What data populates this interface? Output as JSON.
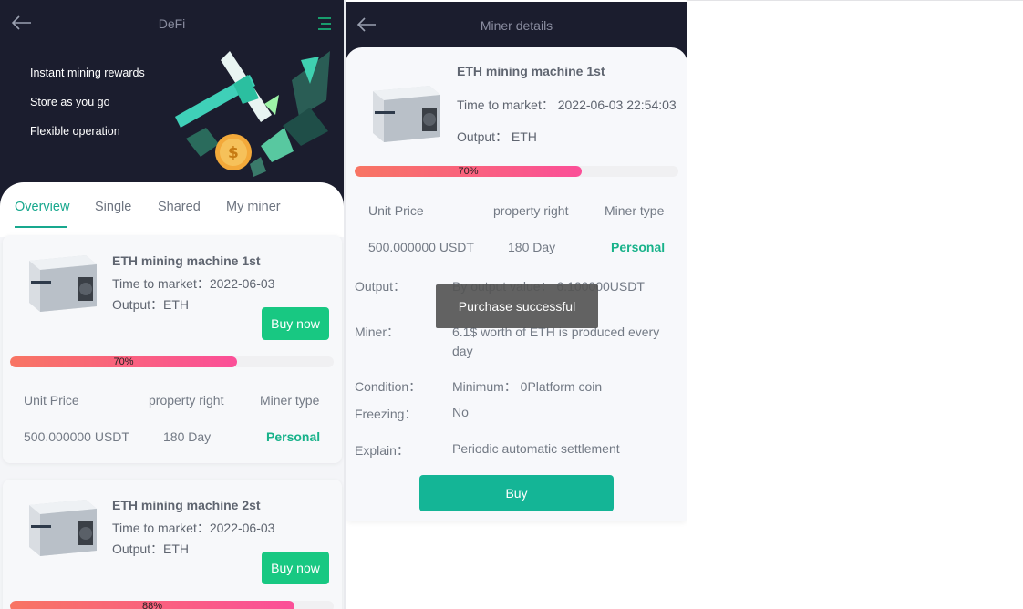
{
  "left": {
    "title": "DeFi",
    "features": [
      "Instant mining rewards",
      "Store as you go",
      "Flexible operation"
    ],
    "tabs": [
      "Overview",
      "Single",
      "Shared",
      "My miner"
    ],
    "cards": [
      {
        "title": "ETH mining machine 1st",
        "time_label": "Time to market：",
        "time_value": "2022-06-03",
        "output_label": "Output：",
        "output_value": "ETH",
        "buy_label": "Buy now",
        "progress": 0.7,
        "progress_label": "70%",
        "headers": [
          "Unit Price",
          "property right",
          "Miner type"
        ],
        "values": [
          "500.000000 USDT",
          "180 Day",
          "Personal"
        ]
      },
      {
        "title": "ETH mining machine 2st",
        "time_label": "Time to market：",
        "time_value": "2022-06-03",
        "output_label": "Output：",
        "output_value": "ETH",
        "buy_label": "Buy now",
        "progress": 0.88,
        "progress_label": "88%"
      }
    ]
  },
  "right": {
    "title": "Miner details",
    "machine_title": "ETH mining machine 1st",
    "time_line": "Time to market： 2022-06-03 22:54:03",
    "output_line": "Output： ETH",
    "progress": 0.7,
    "progress_label": "70%",
    "headers": [
      "Unit Price",
      "property right",
      "Miner type"
    ],
    "values": [
      "500.000000 USDT",
      "180 Day",
      "Personal"
    ],
    "details": [
      {
        "label": "Output：",
        "value": "By output value： 6.100000USDT"
      },
      {
        "label": "Miner：",
        "value": "6.1$ worth of ETH is produced every day"
      },
      {
        "label": "Condition：",
        "value": "Minimum： 0Platform coin"
      },
      {
        "label": "Freezing：",
        "value": "No"
      },
      {
        "label": "Explain：",
        "value": "Periodic automatic settlement"
      }
    ],
    "buy_label": "Buy",
    "toast": "Purchase successful"
  },
  "colors": {
    "header_bg": "#1b1d2e",
    "accent_green": "#18a88e",
    "buy_green": "#18c882",
    "progress_start": "#f87563",
    "progress_end": "#fb4f98"
  },
  "icons": [
    "back-arrow-icon",
    "menu-icon",
    "miner-device-icon",
    "coin-icon"
  ]
}
